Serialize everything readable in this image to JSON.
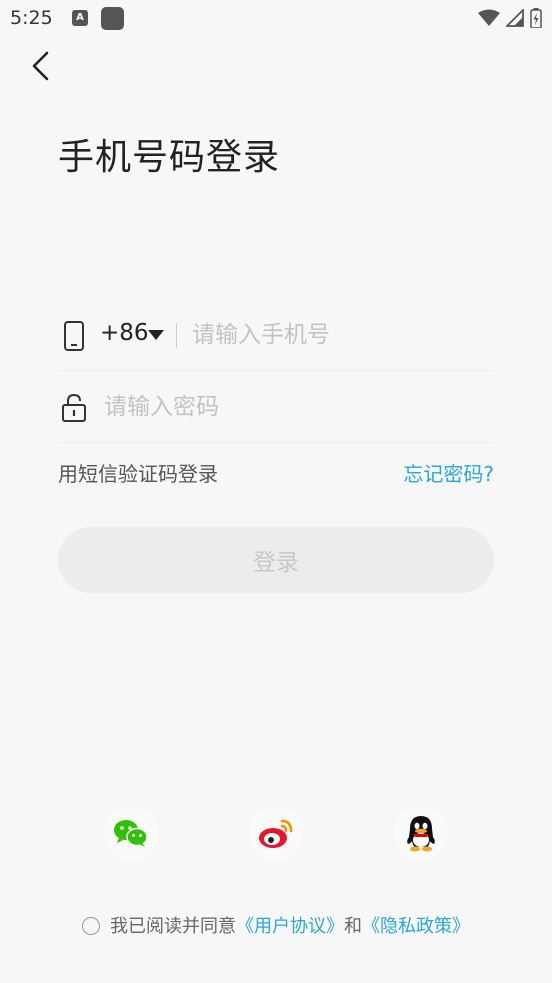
{
  "status_bar": {
    "time": "5:25",
    "a_badge": "A"
  },
  "page": {
    "title": "手机号码登录"
  },
  "phone_field": {
    "country_code": "+86",
    "placeholder": "请输入手机号"
  },
  "password_field": {
    "placeholder": "请输入密码"
  },
  "links": {
    "sms_login": "用短信验证码登录",
    "forgot_password": "忘记密码?"
  },
  "login_button": {
    "label": "登录"
  },
  "social": {
    "icons": [
      "wechat-icon",
      "weibo-icon",
      "qq-icon"
    ]
  },
  "agreement": {
    "prefix": "我已阅读并同意",
    "user_agreement": "《用户协议》",
    "and": "和",
    "privacy_policy": "《隐私政策》"
  },
  "colors": {
    "accent": "#2ba6d8",
    "background": "#f7f7f7",
    "button_disabled": "#ececec"
  }
}
